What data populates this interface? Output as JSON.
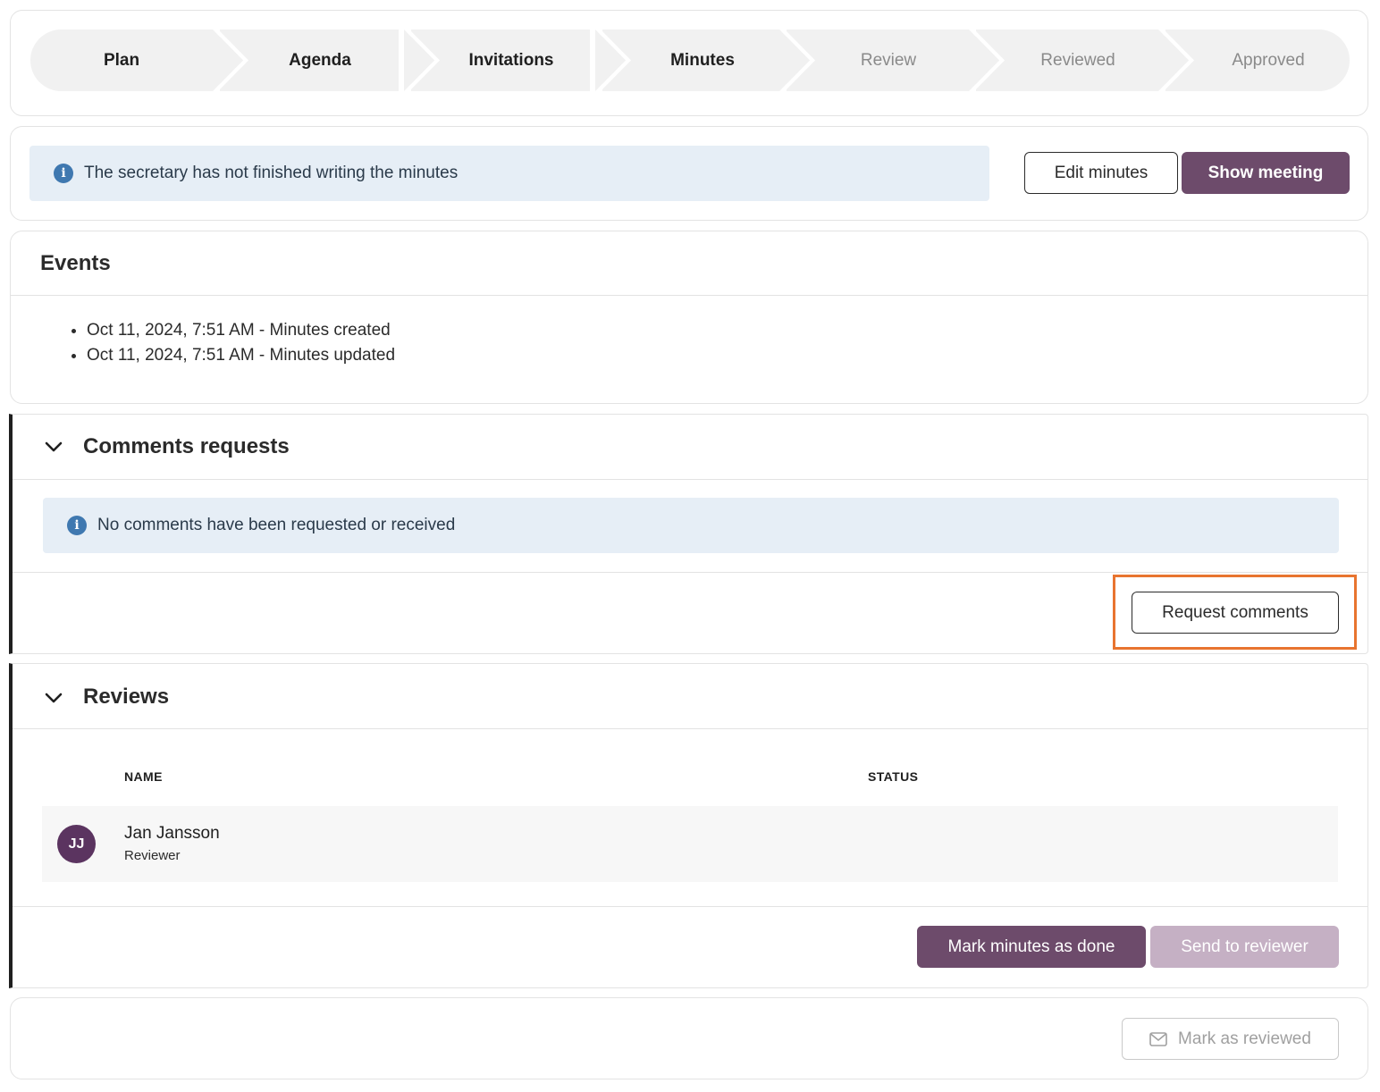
{
  "stepper": {
    "steps": [
      {
        "label": "Plan",
        "state": "done"
      },
      {
        "label": "Agenda",
        "state": "done"
      },
      {
        "label": "Invitations",
        "state": "done"
      },
      {
        "label": "Minutes",
        "state": "done"
      },
      {
        "label": "Review",
        "state": "todo"
      },
      {
        "label": "Reviewed",
        "state": "todo"
      },
      {
        "label": "Approved",
        "state": "todo"
      }
    ]
  },
  "status": {
    "message": "The secretary has not finished writing the minutes",
    "edit_label": "Edit minutes",
    "show_label": "Show meeting"
  },
  "events": {
    "title": "Events",
    "items": [
      "Oct 11, 2024, 7:51 AM - Minutes created",
      "Oct 11, 2024, 7:51 AM - Minutes updated"
    ]
  },
  "comments": {
    "title": "Comments requests",
    "empty_message": "No comments have been requested or received",
    "request_label": "Request comments"
  },
  "reviews": {
    "title": "Reviews",
    "columns": {
      "name": "NAME",
      "status": "STATUS"
    },
    "rows": [
      {
        "initials": "JJ",
        "name": "Jan Jansson",
        "role": "Reviewer",
        "status": ""
      }
    ],
    "mark_done_label": "Mark minutes as done",
    "send_label": "Send to reviewer"
  },
  "footer": {
    "mark_reviewed_label": "Mark as reviewed"
  },
  "colors": {
    "primary": "#6d4b6b",
    "primary_disabled": "#c5b0c4",
    "info_bg": "#e6eef6",
    "info_icon": "#3f78b0",
    "avatar": "#5b3460",
    "highlight": "#e8742f"
  },
  "icons": {
    "info": "info-icon",
    "chevron": "chevron-down-icon",
    "mail": "mail-icon"
  }
}
